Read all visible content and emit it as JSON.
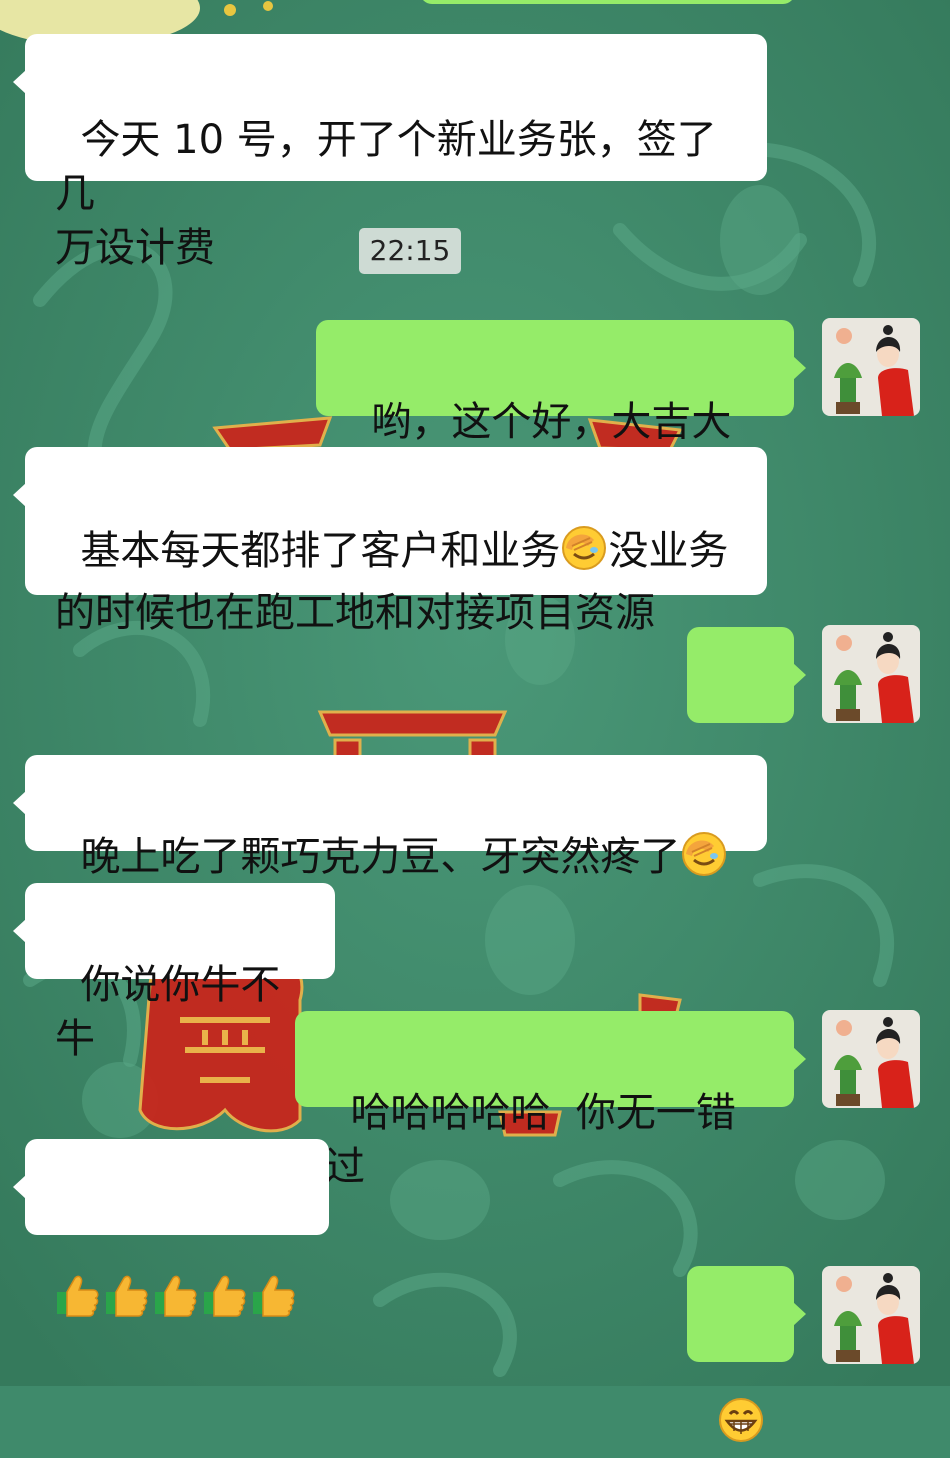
{
  "chat": {
    "timestamp": "22:15",
    "messages": [
      {
        "side": "in",
        "text": "今天 10 号，开了个新业务张，签了几\n万设计费"
      },
      {
        "side": "out",
        "text": "哟，这个好，大吉大利"
      },
      {
        "side": "in",
        "text_a": "基本每天都排了客户和业务",
        "emoji_a": "facepalm-emoji",
        "text_b": "没业务\n的时候也在跑工地和对接项目资源"
      },
      {
        "side": "out",
        "emoji": "thumbs-up-emoji"
      },
      {
        "side": "in",
        "text": "晚上吃了颗巧克力豆、牙突然疼了",
        "emoji": "facepalm-emoji"
      },
      {
        "side": "in",
        "text": "你说你牛不牛"
      },
      {
        "side": "out",
        "text": "哈哈哈哈哈  你无一错过"
      },
      {
        "side": "in",
        "emoji": "thumbs-up-emoji",
        "emoji_count": 5
      },
      {
        "side": "out",
        "emoji": "grinning-emoji"
      }
    ]
  },
  "colors": {
    "wallpaper": "#3f8a6b",
    "incoming_bubble": "#ffffff",
    "outgoing_bubble": "#95ec69",
    "wallpaper_red": "#c8271d"
  }
}
